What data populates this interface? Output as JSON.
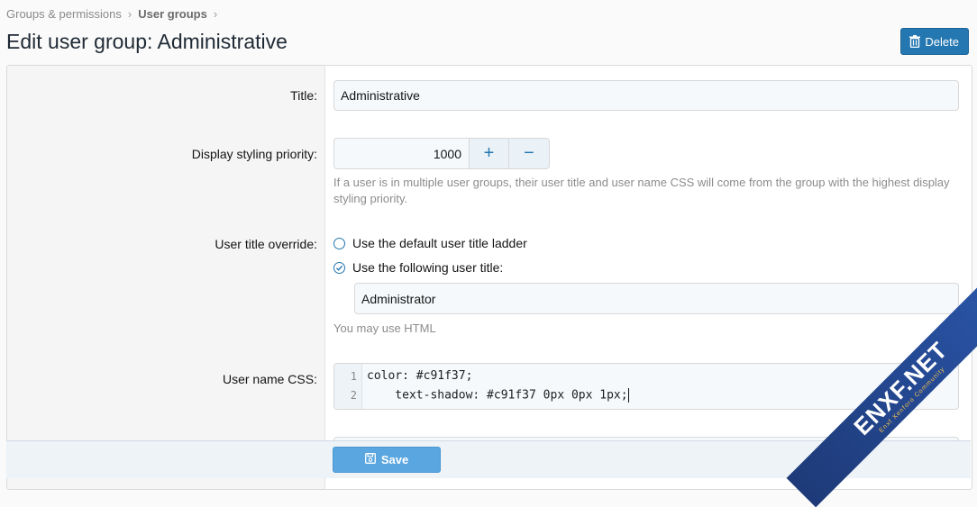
{
  "breadcrumb": {
    "items": [
      "Groups & permissions",
      "User groups"
    ],
    "separator": "›"
  },
  "page": {
    "title": "Edit user group: Administrative",
    "delete_label": "Delete"
  },
  "form": {
    "title": {
      "label": "Title:",
      "value": "Administrative"
    },
    "priority": {
      "label": "Display styling priority:",
      "value": "1000",
      "plus": "+",
      "minus": "−",
      "hint": "If a user is in multiple user groups, their user title and user name CSS will come from the group with the highest display styling priority."
    },
    "user_title_override": {
      "label": "User title override:",
      "options": [
        "Use the default user title ladder",
        "Use the following user title:"
      ],
      "selected_index": 1,
      "value": "Administrator",
      "hint": "You may use HTML"
    },
    "user_name_css": {
      "label": "User name CSS:",
      "line_numbers": [
        "1",
        "2"
      ],
      "lines": [
        "color: #c91f37;",
        "    text-shadow: #c91f37 0px 0px 1px;"
      ]
    }
  },
  "footer": {
    "save_label": "Save"
  },
  "watermark": {
    "text": "ENXF.NET",
    "sub": "Enxf Xenforo Community"
  },
  "colors": {
    "accent": "#2577b1",
    "save": "#5aa6e0"
  }
}
